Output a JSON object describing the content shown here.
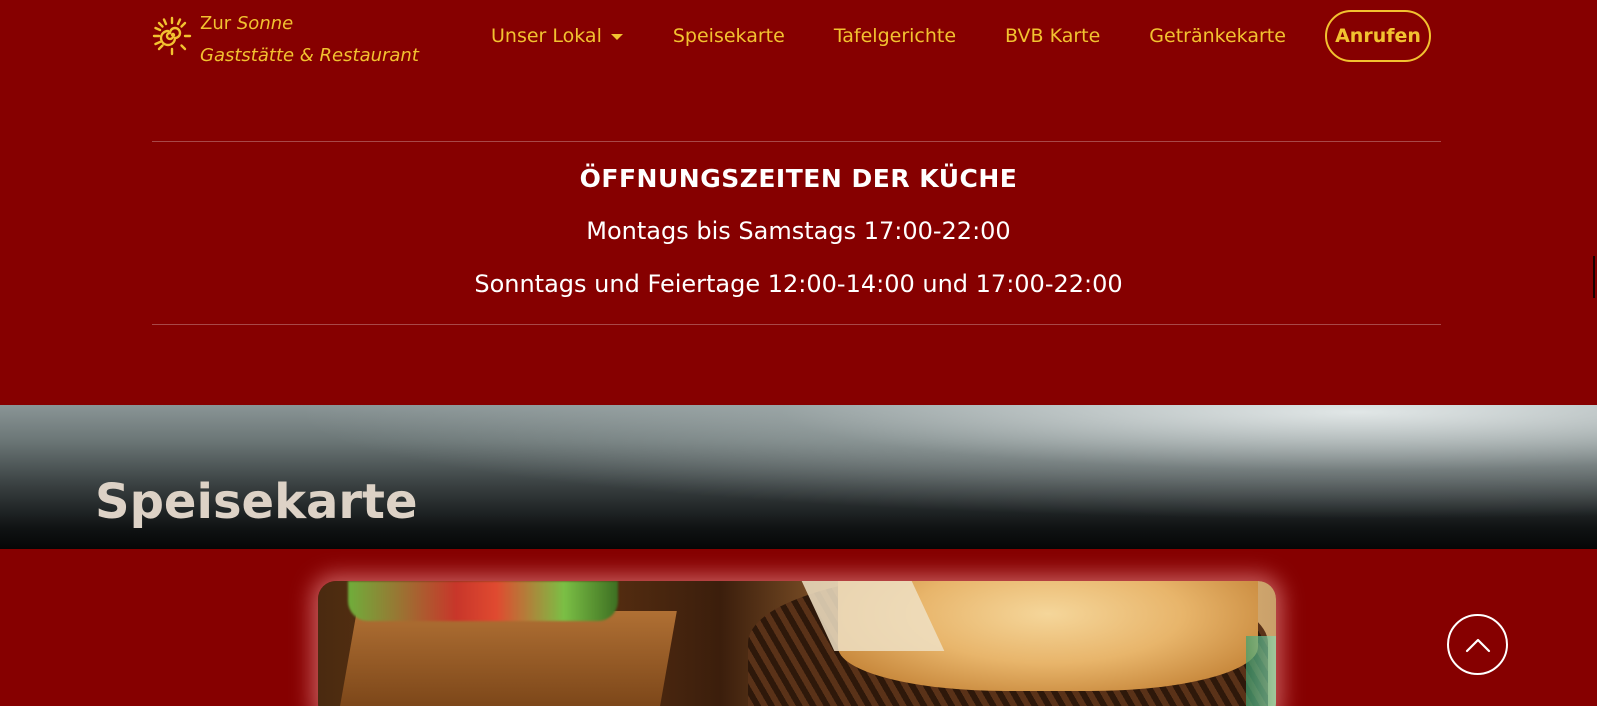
{
  "brand": {
    "line1_prefix": "Zur",
    "line1_name": "Sonne",
    "line2": "Gaststätte & Restaurant",
    "icon": "sun-icon",
    "color": "#f2c230"
  },
  "nav": {
    "items": [
      {
        "label": "Unser Lokal",
        "has_dropdown": true
      },
      {
        "label": "Speisekarte"
      },
      {
        "label": "Tafelgerichte"
      },
      {
        "label": "BVB Karte"
      },
      {
        "label": "Getränkekarte"
      }
    ],
    "call_button": "Anrufen"
  },
  "hours": {
    "title": "ÖFFNUNGSZEITEN DER KÜCHE",
    "lines": [
      "Montags bis Samstags 17:00-22:00",
      "Sonntags und Feiertage 12:00-14:00 und 17:00-22:00"
    ]
  },
  "menu_section": {
    "title": "Speisekarte"
  },
  "back_to_top": {
    "icon": "chevron-up-icon"
  },
  "colors": {
    "background": "#860000",
    "accent": "#f2c230",
    "text": "#ffffff"
  }
}
